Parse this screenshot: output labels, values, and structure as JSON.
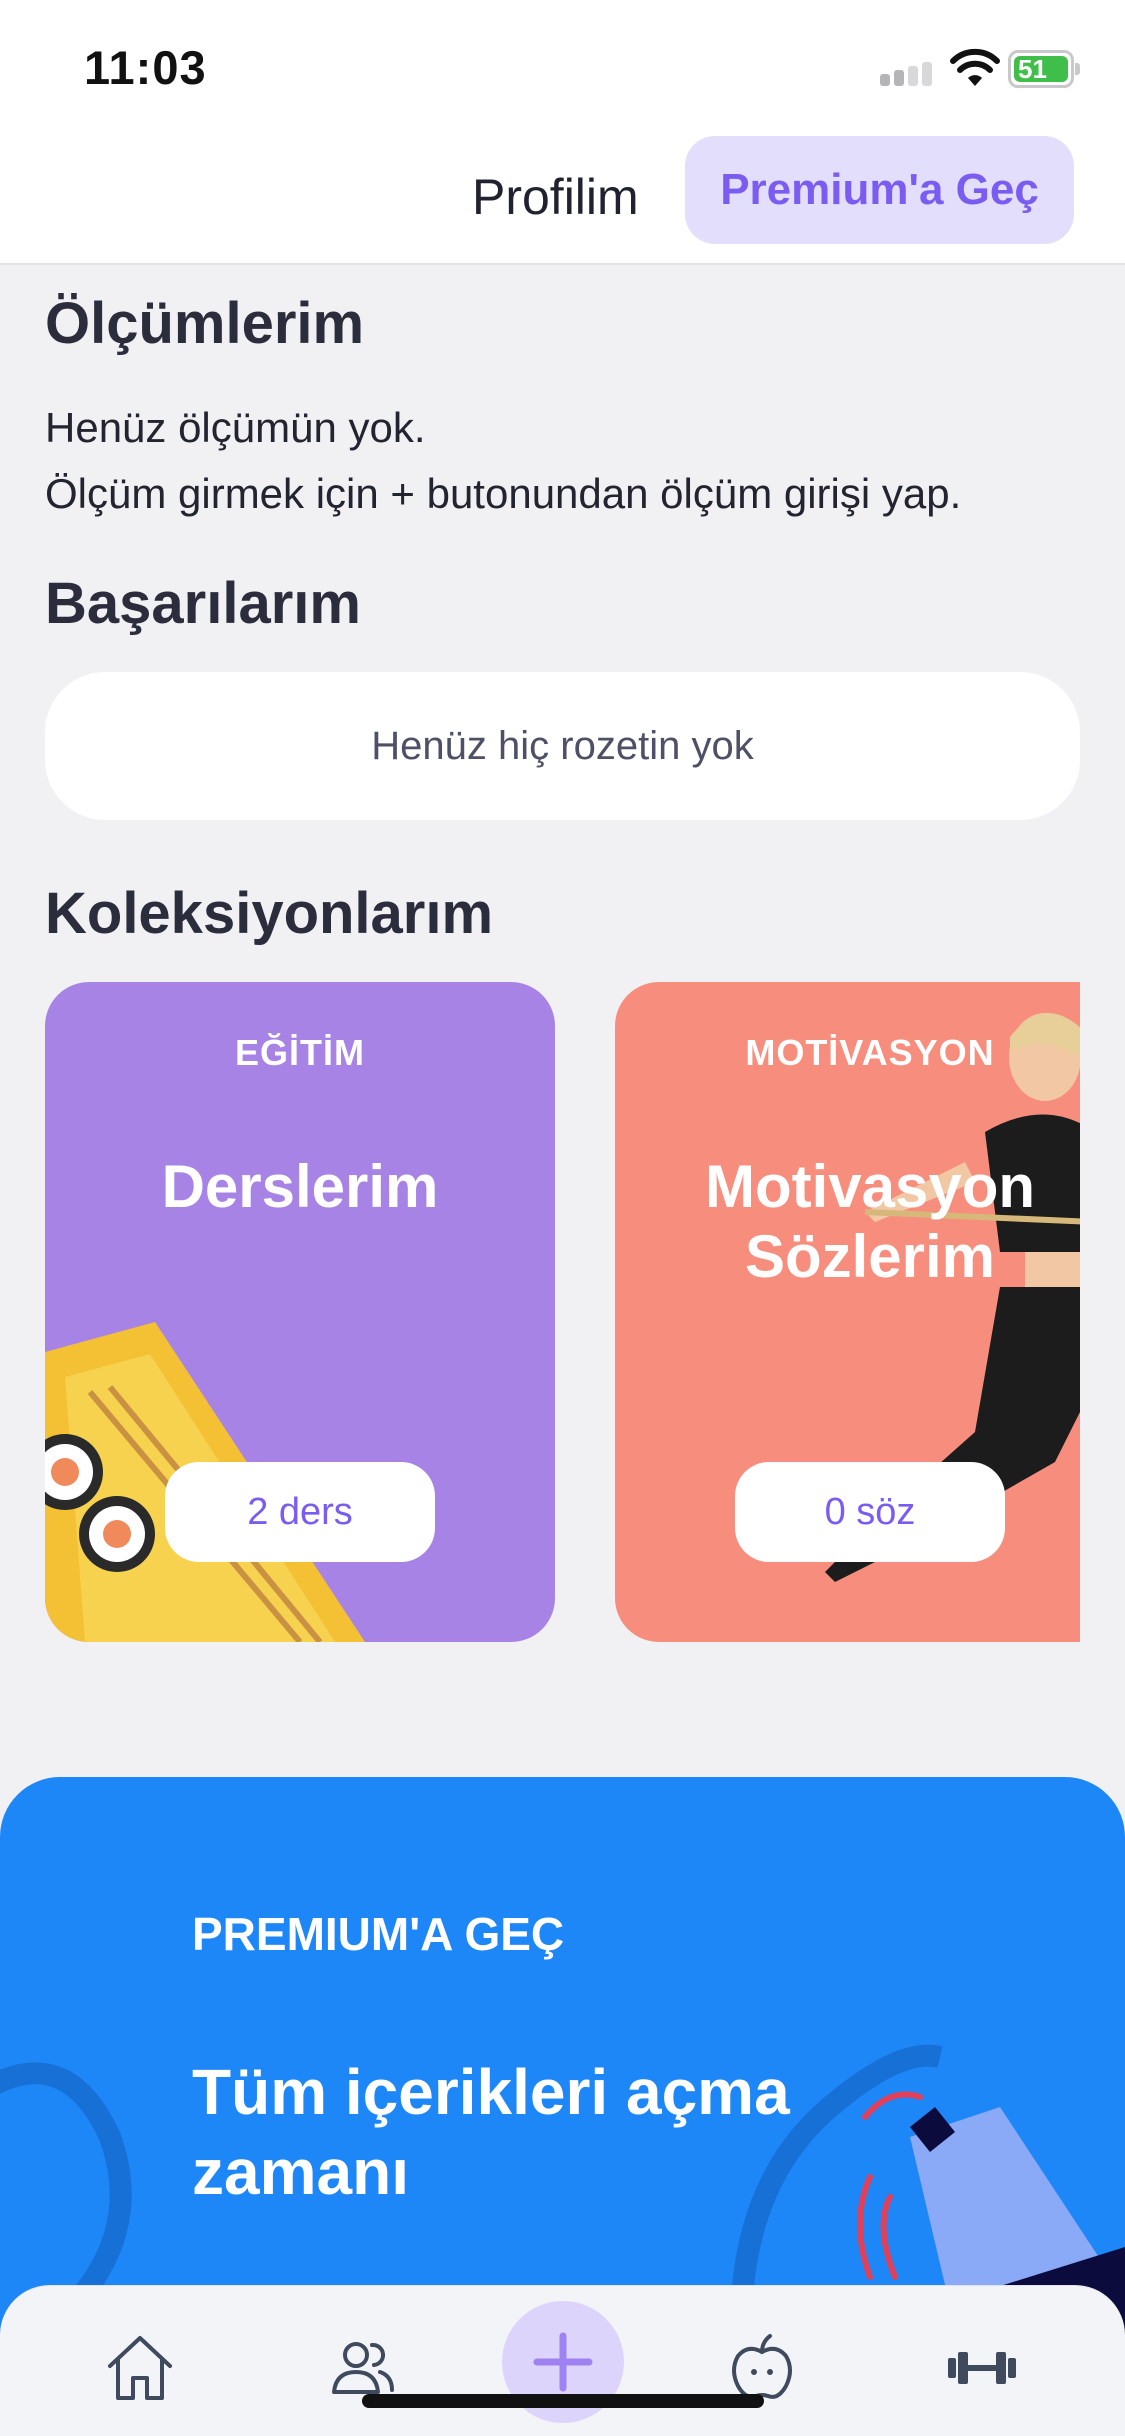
{
  "status_bar": {
    "time": "11:03",
    "battery": "51"
  },
  "header": {
    "title": "Profilim",
    "premium_button": "Premium'a Geç"
  },
  "measurements": {
    "heading": "Ölçümlerim",
    "line1": "Henüz ölçümün yok.",
    "line2": "Ölçüm girmek için + butonundan ölçüm girişi yap."
  },
  "achievements": {
    "heading": "Başarılarım",
    "empty": "Henüz hiç rozetin yok"
  },
  "collections": {
    "heading": "Koleksiyonlarım",
    "items": [
      {
        "tag": "EĞİTİM",
        "title": "Derslerim",
        "count": "2 ders",
        "color": "#a783e6"
      },
      {
        "tag": "MOTİVASYON",
        "title": "Motivasyon Sözlerim",
        "count": "0 söz",
        "color": "#f78e7d"
      }
    ]
  },
  "promo": {
    "eyebrow": "PREMIUM'A GEÇ",
    "title": "Tüm içerikleri açma zamanı",
    "color": "#1e87f7"
  },
  "tabbar": {
    "items": [
      {
        "icon": "home-icon"
      },
      {
        "icon": "users-icon"
      },
      {
        "icon": "plus-icon"
      },
      {
        "icon": "apple-icon"
      },
      {
        "icon": "dumbbell-icon"
      }
    ]
  }
}
